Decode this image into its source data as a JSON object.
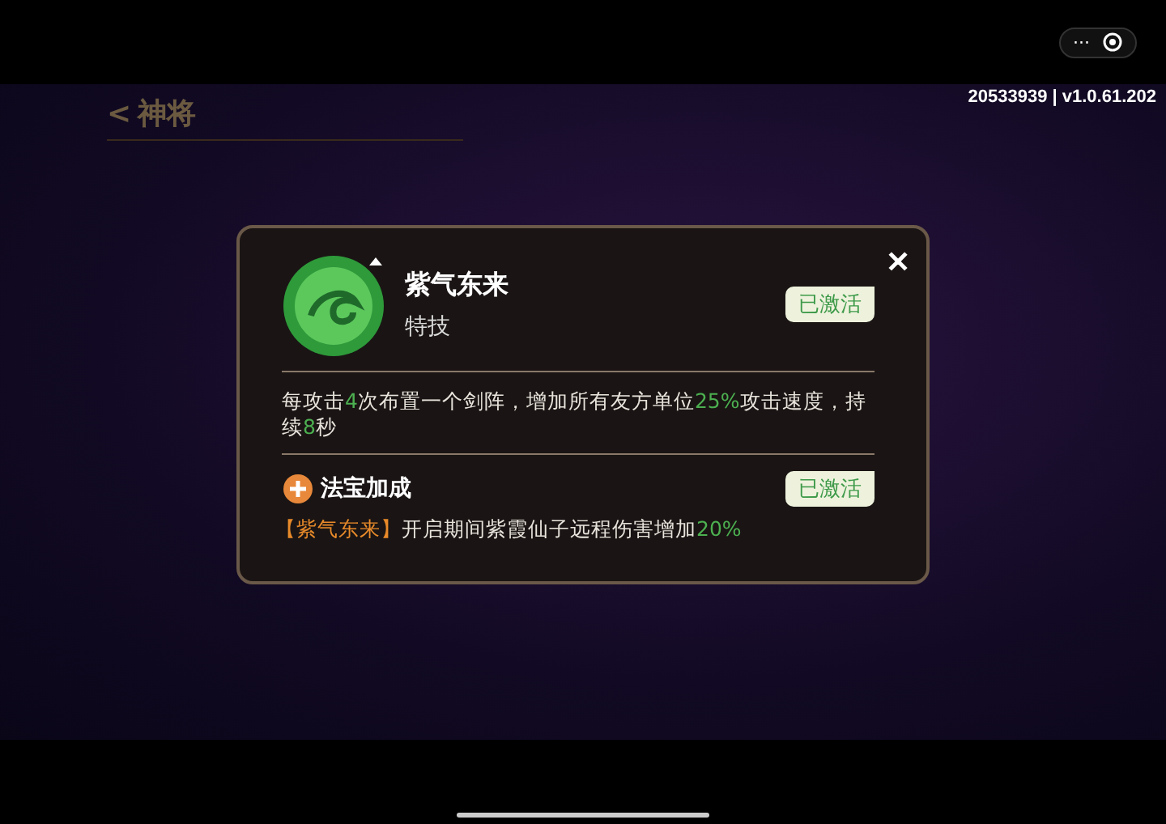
{
  "capsule": {
    "more": "···"
  },
  "version": "20533939 | v1.0.61.202",
  "header": {
    "back": "<",
    "title": "神将"
  },
  "dialog": {
    "close": "✕",
    "skill": {
      "name": "紫气东来",
      "type": "特技",
      "status": "已激活",
      "activated": true
    },
    "description": [
      {
        "text": "每攻击",
        "kind": "plain"
      },
      {
        "text": "4",
        "kind": "num"
      },
      {
        "text": "次布置一个剑阵，增加所有友方单位",
        "kind": "plain"
      },
      {
        "text": "25%",
        "kind": "num"
      },
      {
        "text": "攻击速度，持续",
        "kind": "plain"
      },
      {
        "text": "8",
        "kind": "num"
      },
      {
        "text": "秒",
        "kind": "plain"
      }
    ],
    "bonus": {
      "title": "法宝加成",
      "status": "已激活",
      "activated": true,
      "text": [
        {
          "text": "【紫气东来】",
          "kind": "name"
        },
        {
          "text": "开启期间紫霞仙子远程伤害增加",
          "kind": "plain"
        },
        {
          "text": "20%",
          "kind": "num"
        }
      ]
    }
  }
}
